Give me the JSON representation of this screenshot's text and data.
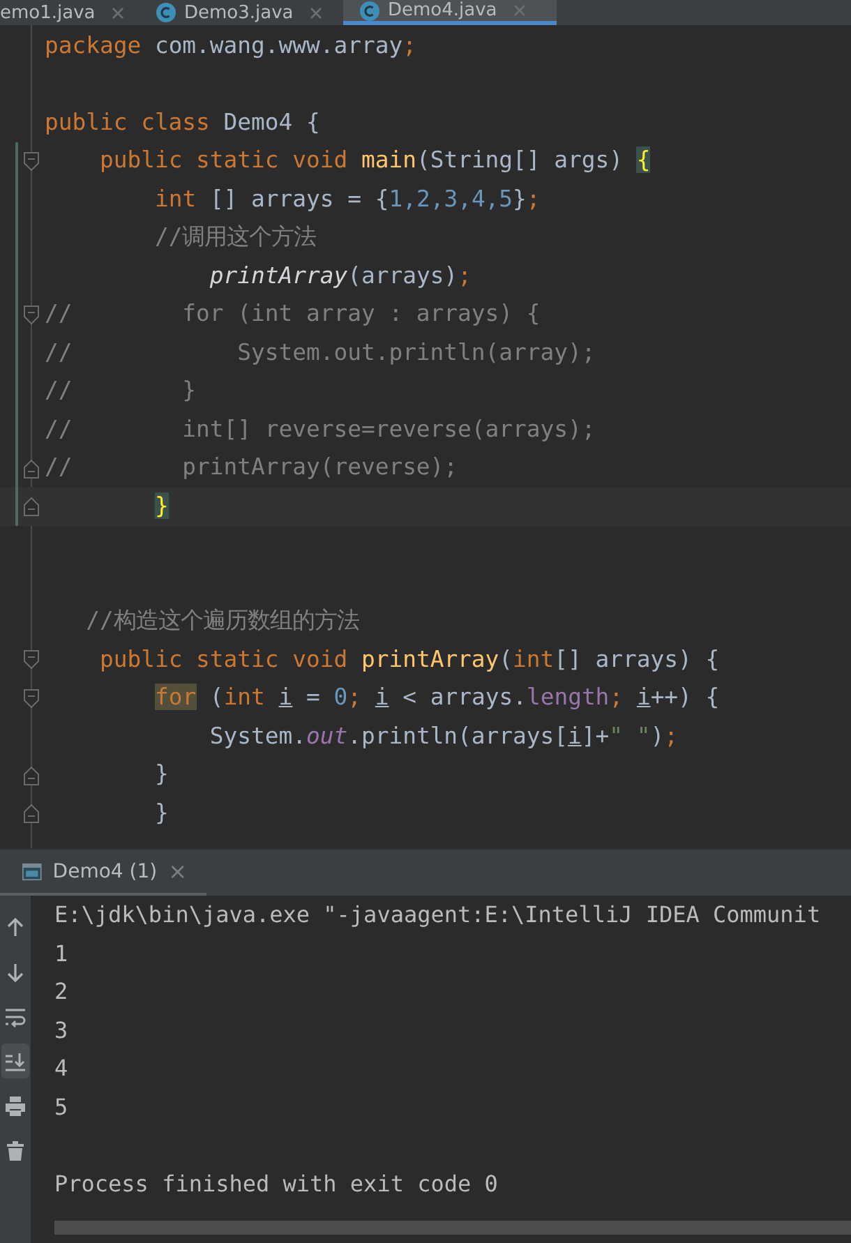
{
  "tabs": [
    {
      "label": "emo1.java",
      "icon": false,
      "selected": false
    },
    {
      "label": "Demo3.java",
      "icon": true,
      "selected": false
    },
    {
      "label": "Demo4.java",
      "icon": true,
      "selected": true
    }
  ],
  "code": {
    "lines": [
      {
        "kind": "code",
        "tokens": [
          {
            "kind": "kw",
            "text": "package"
          },
          {
            "kind": "plain",
            "text": " com.wang.www.array"
          },
          {
            "kind": "kw",
            "text": ";"
          }
        ]
      },
      {
        "kind": "blank"
      },
      {
        "kind": "code",
        "tokens": [
          {
            "kind": "kw",
            "text": "public class "
          },
          {
            "kind": "plain",
            "text": "Demo4 {"
          }
        ]
      },
      {
        "kind": "code",
        "fold_open": true,
        "changed": true,
        "tokens": [
          {
            "kind": "kw",
            "text": "    public static void "
          },
          {
            "kind": "method",
            "text": "main"
          },
          {
            "kind": "plain",
            "text": "(String[] args) "
          },
          {
            "kind": "brace",
            "text": "{"
          }
        ]
      },
      {
        "kind": "code",
        "changed": true,
        "tokens": [
          {
            "kind": "kw",
            "text": "        int "
          },
          {
            "kind": "plain",
            "text": "[] arrays = {"
          },
          {
            "kind": "num",
            "text": "1,2,3,4,5"
          },
          {
            "kind": "plain",
            "text": "}"
          },
          {
            "kind": "kw",
            "text": ";"
          }
        ]
      },
      {
        "kind": "code",
        "changed": true,
        "tokens": [
          {
            "kind": "comment",
            "text": "        //调用这个方法"
          }
        ]
      },
      {
        "kind": "code",
        "changed": true,
        "tokens": [
          {
            "kind": "call",
            "text": "            printArray"
          },
          {
            "kind": "plain",
            "text": "(arrays)"
          },
          {
            "kind": "kw",
            "text": ";"
          }
        ]
      },
      {
        "kind": "code",
        "fold_open": true,
        "changed": true,
        "tokens": [
          {
            "kind": "comment",
            "text": "//        for (int array : arrays) {"
          }
        ]
      },
      {
        "kind": "code",
        "changed": true,
        "tokens": [
          {
            "kind": "comment",
            "text": "//            System.out.println(array);"
          }
        ]
      },
      {
        "kind": "code",
        "changed": true,
        "tokens": [
          {
            "kind": "comment",
            "text": "//        }"
          }
        ]
      },
      {
        "kind": "code",
        "changed": true,
        "tokens": [
          {
            "kind": "comment",
            "text": "//        int[] reverse=reverse(arrays);"
          }
        ]
      },
      {
        "kind": "code",
        "fold_close": true,
        "changed": true,
        "tokens": [
          {
            "kind": "comment",
            "text": "//        printArray(reverse);"
          }
        ]
      },
      {
        "kind": "code",
        "fold_close": true,
        "changed": true,
        "current": true,
        "tokens": [
          {
            "kind": "brace",
            "text": "        }"
          }
        ]
      },
      {
        "kind": "blank"
      },
      {
        "kind": "blank"
      },
      {
        "kind": "code",
        "tokens": [
          {
            "kind": "comment",
            "text": "   //构造这个遍历数组的方法"
          }
        ]
      },
      {
        "kind": "code",
        "fold_open": true,
        "tokens": [
          {
            "kind": "kw",
            "text": "    public static void "
          },
          {
            "kind": "method",
            "text": "printArray"
          },
          {
            "kind": "plain",
            "text": "("
          },
          {
            "kind": "kw",
            "text": "int"
          },
          {
            "kind": "plain",
            "text": "[] arrays) {"
          }
        ]
      },
      {
        "kind": "code",
        "fold_open": true,
        "tokens": [
          {
            "kind": "hl",
            "text": "        for"
          },
          {
            "kind": "plain",
            "text": " ("
          },
          {
            "kind": "kw",
            "text": "int "
          },
          {
            "kind": "var",
            "text": "i"
          },
          {
            "kind": "plain",
            "text": " = "
          },
          {
            "kind": "num",
            "text": "0"
          },
          {
            "kind": "kw",
            "text": "; "
          },
          {
            "kind": "var",
            "text": "i"
          },
          {
            "kind": "plain",
            "text": " < arrays."
          },
          {
            "kind": "field",
            "text": "length"
          },
          {
            "kind": "kw",
            "text": "; "
          },
          {
            "kind": "var",
            "text": "i"
          },
          {
            "kind": "plain",
            "text": "++) {"
          }
        ]
      },
      {
        "kind": "code",
        "tokens": [
          {
            "kind": "plain",
            "text": "            System."
          },
          {
            "kind": "static",
            "text": "out"
          },
          {
            "kind": "plain",
            "text": ".println(arrays["
          },
          {
            "kind": "var",
            "text": "i"
          },
          {
            "kind": "plain",
            "text": "]+"
          },
          {
            "kind": "str",
            "text": "\" \""
          },
          {
            "kind": "plain",
            "text": ")"
          },
          {
            "kind": "kw",
            "text": ";"
          }
        ]
      },
      {
        "kind": "code",
        "fold_close": true,
        "tokens": [
          {
            "kind": "plain",
            "text": "        }"
          }
        ]
      },
      {
        "kind": "code",
        "fold_close": true,
        "tokens": [
          {
            "kind": "plain",
            "text": "        }"
          }
        ]
      }
    ]
  },
  "run_tab": {
    "label": "Demo4 (1)",
    "close": "×"
  },
  "toolbar": [
    {
      "kind": "up",
      "selected": false
    },
    {
      "kind": "down",
      "selected": false
    },
    {
      "kind": "wrap",
      "selected": false
    },
    {
      "kind": "scroll-end",
      "selected": true
    },
    {
      "kind": "print",
      "selected": false
    },
    {
      "kind": "trash",
      "selected": false
    }
  ],
  "console": [
    {
      "kind": "text",
      "text": "E:\\jdk\\bin\\java.exe \"-javaagent:E:\\IntelliJ IDEA Communit"
    },
    {
      "kind": "text",
      "text": "1"
    },
    {
      "kind": "text",
      "text": "2"
    },
    {
      "kind": "text",
      "text": "3"
    },
    {
      "kind": "text",
      "text": "4"
    },
    {
      "kind": "text",
      "text": "5"
    },
    {
      "kind": "blank"
    },
    {
      "kind": "text",
      "text": "Process finished with exit code 0"
    }
  ]
}
